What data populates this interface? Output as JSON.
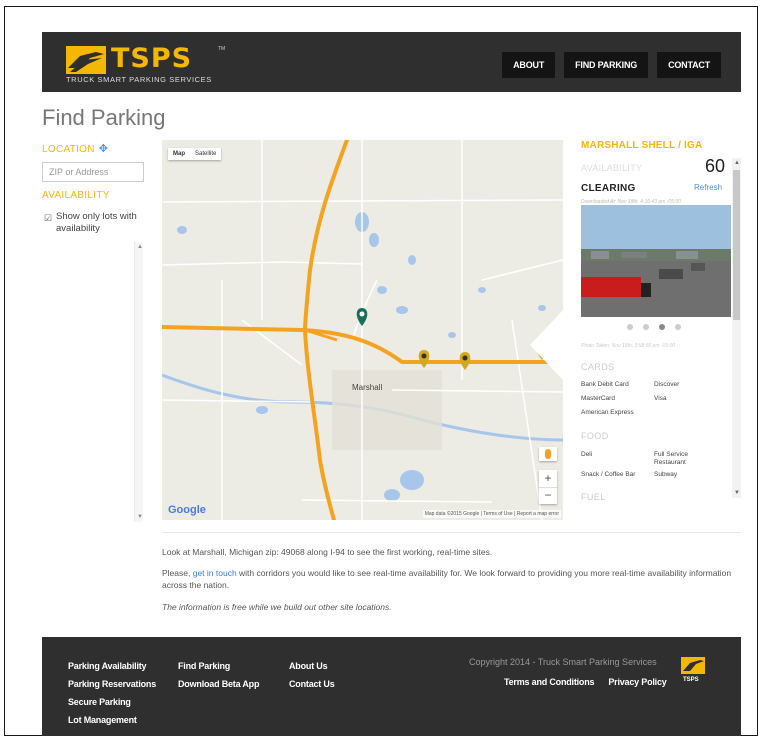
{
  "header": {
    "logo_text": "TSPS",
    "logo_tm": "TM",
    "logo_subtitle": "TRUCK SMART PARKING SERVICES",
    "nav": [
      "ABOUT",
      "FIND PARKING",
      "CONTACT"
    ]
  },
  "page_title": "Find Parking",
  "sidebar": {
    "location_label": "LOCATION",
    "zip_placeholder": "ZIP or Address",
    "availability_label": "AVAILABILITY",
    "checkbox_label": "Show only lots with availability"
  },
  "map": {
    "type_map": "Map",
    "type_satellite": "Satellite",
    "town_label": "Marshall",
    "google": "Google",
    "footer": "Map data ©2015 Google  |  Terms of Use  |  Report a map error"
  },
  "panel": {
    "title": "MARSHALL SHELL / IGA",
    "availability_label": "AVAILABILITY",
    "count": "60",
    "status": "CLEARING",
    "refresh": "Refresh",
    "cam_caption": "Downloaded At: Nov 18th, 4:16:43 pm -05:00",
    "photo_taken": "Photo Taken: Nov 18th, 3:58:56 pm -05:00",
    "cards_label": "CARDS",
    "cards": [
      "Bank Debit Card",
      "Discover",
      "MasterCard",
      "Visa",
      "American Express"
    ],
    "food_label": "FOOD",
    "food": [
      "Deli",
      "Full Service Restaurant",
      "Snack / Coffee Bar",
      "Subway"
    ],
    "fuel_label": "FUEL"
  },
  "content": {
    "para1": "Look at Marshall, Michigan zip: 49068 along I-94 to see the first working, real-time sites.",
    "para2_before": "Please, ",
    "para2_link": "get in touch",
    "para2_after": " with corridors you would like to see real-time availability for. We look forward to providing you more real-time availability information across the nation.",
    "para3": "The information is free while we build out other site locations."
  },
  "footer": {
    "col1": [
      "Parking Availability",
      "Parking Reservations",
      "Secure Parking",
      "Lot Management"
    ],
    "col2": [
      "Find Parking",
      "Download Beta App"
    ],
    "col3": [
      "About Us",
      "Contact Us"
    ],
    "copyright": "Copyright 2014 - Truck Smart Parking Services",
    "terms": "Terms and Conditions",
    "privacy": "Privacy Policy"
  },
  "colors": {
    "brand_yellow": "#f5b800",
    "header_bg": "#2f2f2f",
    "link_blue": "#3a7bd5"
  }
}
